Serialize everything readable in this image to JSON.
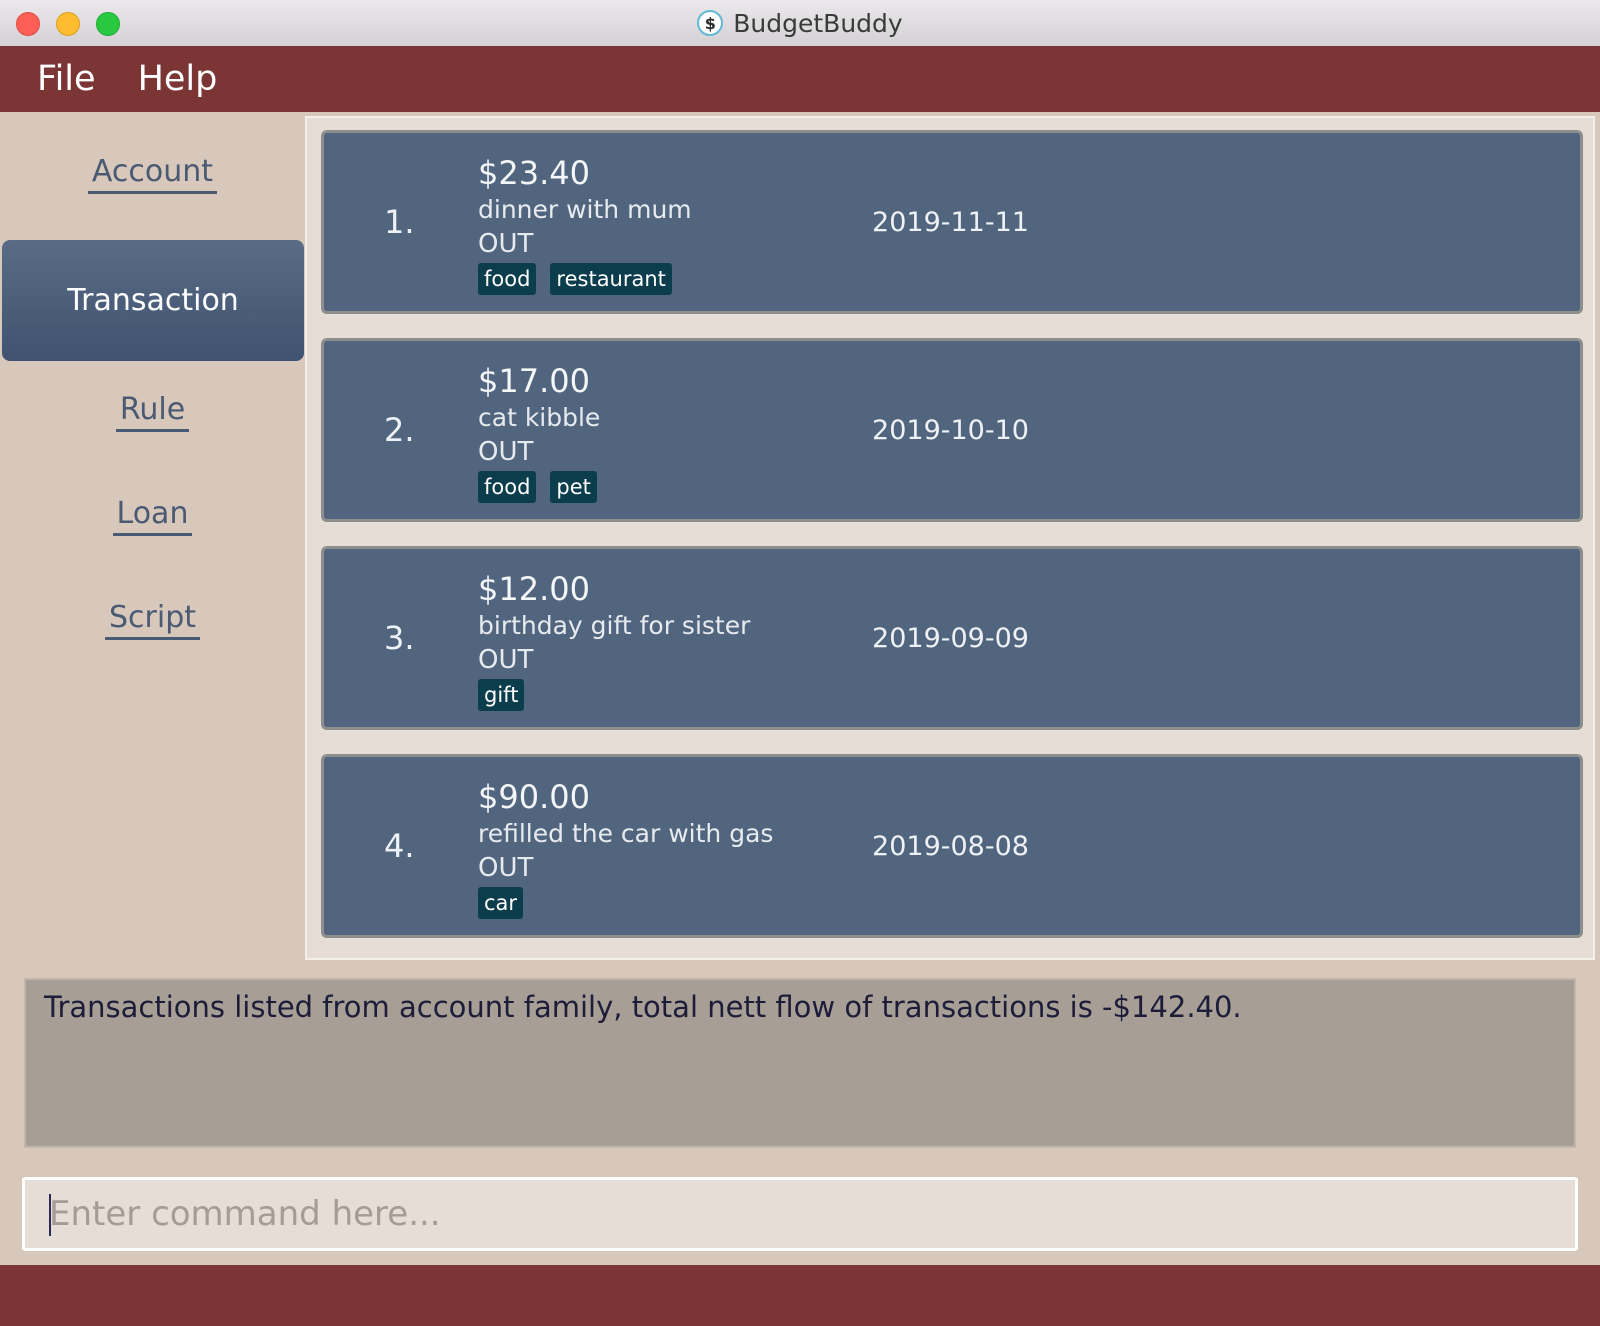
{
  "window": {
    "title": "BudgetBuddy",
    "app_icon_glyph": "$"
  },
  "menu": {
    "file": "File",
    "help": "Help"
  },
  "sidebar": {
    "account": "Account",
    "transaction": "Transaction",
    "rule": "Rule",
    "loan": "Loan",
    "script": "Script",
    "active": "Transaction"
  },
  "transactions": [
    {
      "index": "1.",
      "amount": "$23.40",
      "description": "dinner with mum",
      "direction": "OUT",
      "tags": [
        "food",
        "restaurant"
      ],
      "date": "2019-11-11"
    },
    {
      "index": "2.",
      "amount": "$17.00",
      "description": "cat kibble",
      "direction": "OUT",
      "tags": [
        "food",
        "pet"
      ],
      "date": "2019-10-10"
    },
    {
      "index": "3.",
      "amount": "$12.00",
      "description": "birthday gift for sister",
      "direction": "OUT",
      "tags": [
        "gift"
      ],
      "date": "2019-09-09"
    },
    {
      "index": "4.",
      "amount": "$90.00",
      "description": "refilled the car with gas",
      "direction": "OUT",
      "tags": [
        "car"
      ],
      "date": "2019-08-08"
    }
  ],
  "result": {
    "message": "Transactions listed from account family, total nett flow of transactions is -$142.40."
  },
  "command": {
    "placeholder": "Enter command here...",
    "value": ""
  },
  "colors": {
    "menubar": "#7b3534",
    "card": "#52657e",
    "tag": "#0c3d4c",
    "sidebar": "#d8c8bb",
    "result": "#a79e95"
  }
}
